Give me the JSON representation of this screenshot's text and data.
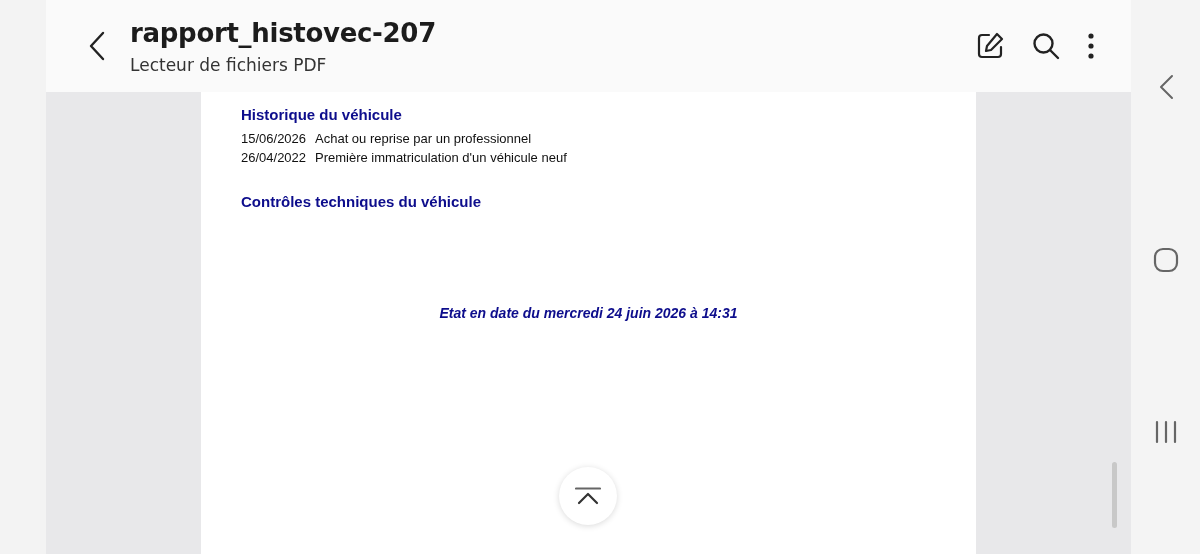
{
  "header": {
    "title": "rapport_histovec-207",
    "subtitle": "Lecteur de fichiers PDF"
  },
  "document": {
    "sections": [
      {
        "heading": "Historique du véhicule",
        "entries": [
          {
            "date": "15/06/2026",
            "event": "Achat ou reprise par un professionnel"
          },
          {
            "date": "26/04/2022",
            "event": "Première immatriculation d'un véhicule neuf"
          }
        ]
      },
      {
        "heading": "Contrôles techniques du véhicule"
      }
    ],
    "footer": "Etat en date du mercredi 24 juin 2026 à 14:31"
  }
}
